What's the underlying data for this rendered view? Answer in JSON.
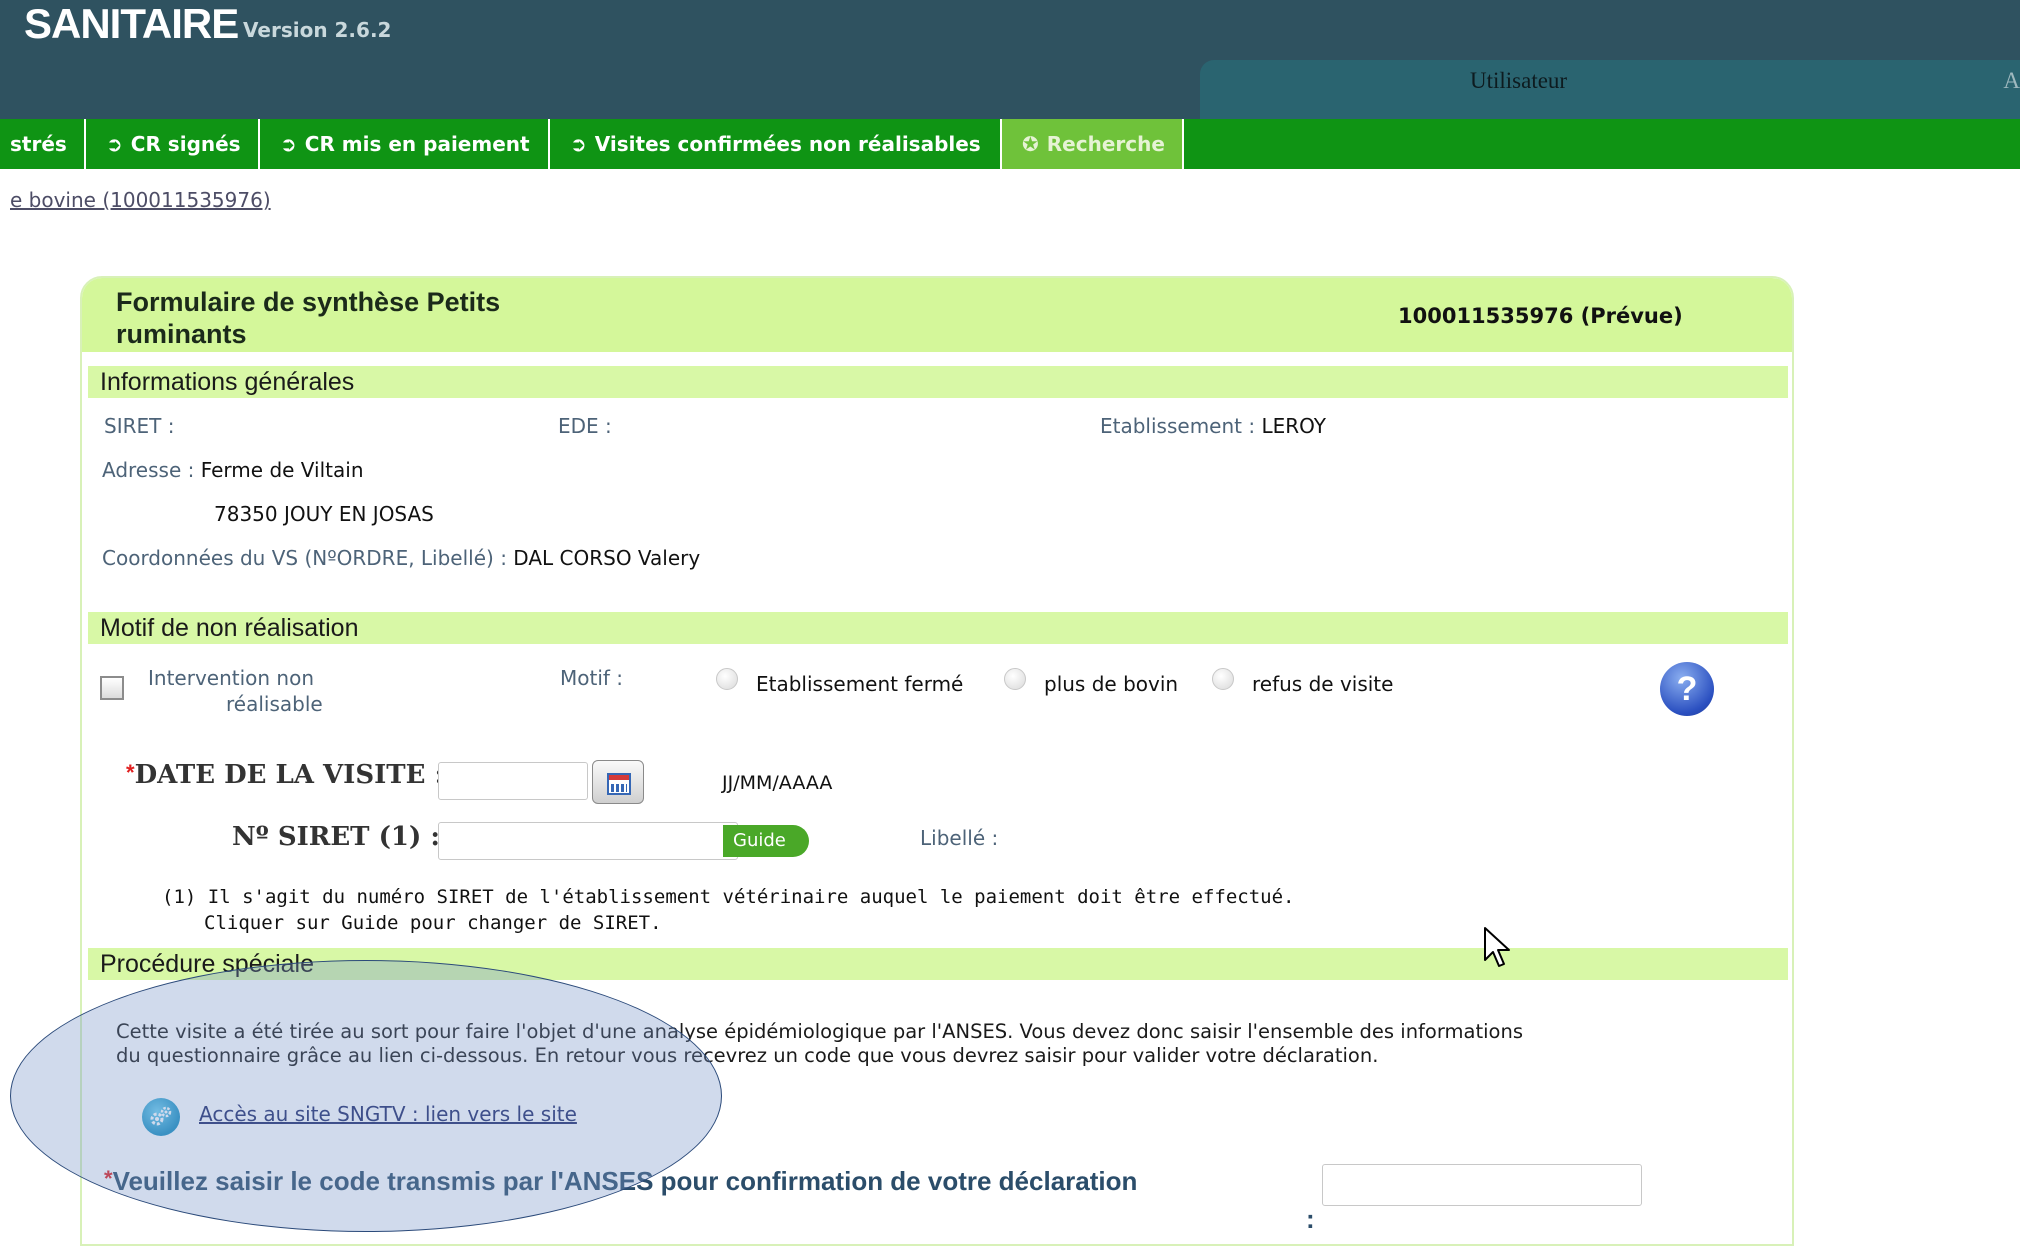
{
  "header": {
    "app_title": "SANITAIRE",
    "version": "Version 2.6.2",
    "user_label": "Utilisateur",
    "user_extra": "A"
  },
  "nav": {
    "tabs": [
      {
        "label": "strés"
      },
      {
        "label": "CR signés"
      },
      {
        "label": "CR mis en paiement"
      },
      {
        "label": "Visites confirmées non réalisables"
      },
      {
        "label": "Recherche"
      }
    ]
  },
  "breadcrumb": "e bovine (100011535976)",
  "form": {
    "title": "Formulaire de synthèse Petits ruminants",
    "identifier": "100011535976 (Prévue)"
  },
  "general_info": {
    "section_title": "Informations générales",
    "siret_label": "SIRET :",
    "ede_label": "EDE :",
    "establishment_label": "Etablissement :",
    "establishment_value": "LEROY",
    "address_label": "Adresse :",
    "address_line1": "Ferme de Viltain",
    "address_line2": "78350 JOUY EN JOSAS",
    "vs_label": "Coordonnées du VS (NºORDRE, Libellé) :",
    "vs_value": "DAL CORSO Valery"
  },
  "non_realisation": {
    "section_title": "Motif de non réalisation",
    "checkbox_label_line1": "Intervention non",
    "checkbox_label_line2": "réalisable",
    "motif_label": "Motif :",
    "options": [
      "Etablissement fermé",
      "plus de bovin",
      "refus de visite"
    ],
    "help_symbol": "?",
    "date_label": "DATE DE LA VISITE :",
    "date_format": "JJ/MM/AAAA",
    "date_value": "",
    "siret_field_label": "Nº SIRET (1) :",
    "siret_value": "",
    "guide_button": "Guide",
    "libelle_label": "Libellé :",
    "note_line1": "(1) Il s'agit du numéro SIRET de l'établissement vétérinaire auquel le paiement doit être effectué.",
    "note_line2": "Cliquer sur Guide pour changer de SIRET.",
    "required_mark": "*"
  },
  "special_procedure": {
    "section_title": "Procédure spéciale",
    "paragraph_line1": "Cette visite a été tirée au sort pour faire l'objet d'une analyse épidémiologique par l'ANSES. Vous devez donc saisir l'ensemble des informations",
    "paragraph_line2": "du questionnaire grâce au lien ci-dessous. En retour vous recevrez un code que vous devrez saisir pour valider votre déclaration.",
    "link_text": "Accès au site SNGTV : lien vers le site",
    "code_label": "Veuillez saisir le code transmis par l'ANSES pour confirmation de votre déclaration",
    "code_colon": ":",
    "code_value": ""
  },
  "colors": {
    "header_bg": "#2f5260",
    "nav_bg": "#0f9414",
    "active_tab_bg": "#6fc23a",
    "section_bg": "#d8f8a6",
    "required": "#e02020"
  }
}
